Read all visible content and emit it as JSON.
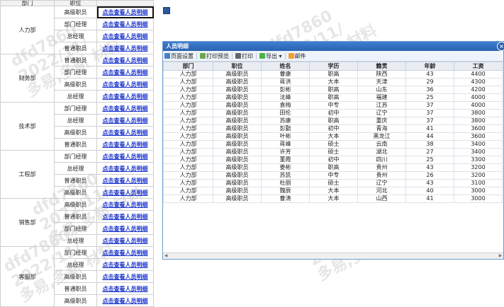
{
  "grid": {
    "headers": [
      "部门",
      "职位"
    ],
    "departments": [
      {
        "name": "人力部",
        "positions": [
          "高级职员",
          "部门经理",
          "总经理",
          "普通职员"
        ]
      },
      {
        "name": "财务部",
        "positions": [
          "普通职员",
          "部门经理",
          "高级职员",
          "总经理"
        ]
      },
      {
        "name": "技术部",
        "positions": [
          "部门经理",
          "总经理",
          "高级职员",
          "普通职员"
        ]
      },
      {
        "name": "工程部",
        "positions": [
          "部门经理",
          "总经理",
          "普通职员",
          "高级职员"
        ]
      },
      {
        "name": "销售部",
        "positions": [
          "高级职员",
          "普通职员",
          "部门经理",
          "总经理"
        ]
      },
      {
        "name": "客服部",
        "positions": [
          "部门经理",
          "总经理",
          "高级职员",
          "普通职员",
          "高级职员"
        ]
      }
    ],
    "link_label": "点击查看人员明细"
  },
  "watermark": {
    "lines": [
      "dfd7860",
      "2022/11/",
      "多易,多新 材料"
    ]
  },
  "window": {
    "title": "人员明细",
    "close": "×",
    "toolbar": [
      {
        "label": "页面设置",
        "icon": "page-setup-icon",
        "color": "#4a7fc0"
      },
      {
        "label": "打印预览",
        "icon": "print-preview-icon",
        "color": "#6aa84f"
      },
      {
        "label": "打印",
        "icon": "print-icon",
        "color": "#666666"
      },
      {
        "label": "导出 ▾",
        "icon": "export-icon",
        "color": "#4caf50"
      },
      {
        "label": "邮件",
        "icon": "mail-icon",
        "color": "#f0a030"
      }
    ],
    "columns": [
      "部门",
      "职位",
      "姓名",
      "学历",
      "籍贯",
      "年龄",
      "工资"
    ],
    "rows": [
      [
        "人力部",
        "高级职员",
        "曹康",
        "职高",
        "陕西",
        "43",
        "4400"
      ],
      [
        "人力部",
        "高级职员",
        "蒋洪",
        "大本",
        "天津",
        "29",
        "4300"
      ],
      [
        "人力部",
        "高级职员",
        "彭彬",
        "职高",
        "山东",
        "36",
        "4200"
      ],
      [
        "人力部",
        "高级职员",
        "沈峰",
        "职高",
        "福建",
        "25",
        "4000"
      ],
      [
        "人力部",
        "高级职员",
        "袁梅",
        "中专",
        "江苏",
        "37",
        "4000"
      ],
      [
        "人力部",
        "高级职员",
        "田伦",
        "初中",
        "辽宁",
        "37",
        "3800"
      ],
      [
        "人力部",
        "高级职员",
        "苏康",
        "职高",
        "重庆",
        "37",
        "3800"
      ],
      [
        "人力部",
        "高级职员",
        "彭勤",
        "初中",
        "青海",
        "41",
        "3600"
      ],
      [
        "人力部",
        "高级职员",
        "叶彬",
        "大本",
        "黑龙江",
        "44",
        "3600"
      ],
      [
        "人力部",
        "高级职员",
        "蒋峰",
        "硕士",
        "云南",
        "38",
        "3400"
      ],
      [
        "人力部",
        "高级职员",
        "许芳",
        "硕士",
        "湖北",
        "27",
        "3400"
      ],
      [
        "人力部",
        "高级职员",
        "董霞",
        "初中",
        "四川",
        "25",
        "3300"
      ],
      [
        "人力部",
        "高级职员",
        "姜彬",
        "职高",
        "贵州",
        "43",
        "3200"
      ],
      [
        "人力部",
        "高级职员",
        "苏凯",
        "中专",
        "贵州",
        "26",
        "3200"
      ],
      [
        "人力部",
        "高级职员",
        "杜丽",
        "硕士",
        "辽宁",
        "43",
        "3100"
      ],
      [
        "人力部",
        "高级职员",
        "魏辰",
        "大本",
        "河北",
        "40",
        "3000"
      ],
      [
        "人力部",
        "高级职员",
        "曹涛",
        "大本",
        "山西",
        "41",
        "3000"
      ]
    ]
  }
}
